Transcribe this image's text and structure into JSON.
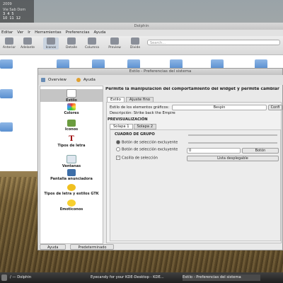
{
  "clock": {
    "year": "2009",
    "date": "Vie Sab Dom",
    "days": [
      "3",
      "4",
      "5"
    ],
    "days2": [
      "10",
      "11",
      "12"
    ]
  },
  "dolphin": {
    "title": "Dolphin",
    "menu": [
      "Editar",
      "Ver",
      "Ir",
      "Herramientas",
      "Preferencias",
      "Ayuda"
    ],
    "toolbar": [
      "Anterior",
      "Adelante",
      "Iconos",
      "Detalle",
      "Columna",
      "Preview",
      "Divide"
    ],
    "search_placeholder": "Search..."
  },
  "estilo": {
    "title": "Estilo - Preferencias del sistema",
    "top_links": [
      "Overview",
      "Ayuda"
    ],
    "sidebar": [
      "Estilo",
      "Colores",
      "Iconos",
      "Tipos de letra",
      "Ventanas",
      "Pantalla anunciadora",
      "Tipos de letra y estilos GTK",
      "Emoticonos"
    ],
    "header": "Permite la manipulación del comportamiento del widget y permite cambiar el estilo pa",
    "tabs": [
      "Estilo",
      "Ajuste fino"
    ],
    "widget_style_label": "Estilo de los elementos gráficos:",
    "widget_style_value": "Bespin",
    "configure_label": "Confi",
    "description": "Descripción: Strike back the Empire",
    "preview_label": "PREVISUALIZACIÓN",
    "subtabs": [
      "Solapa 1",
      "Solapa 2"
    ],
    "group_label": "CUADRO DE GRUPO",
    "radio1": "Botón de selección excluyente",
    "radio2": "Botón de selección excluyente",
    "checkbox": "Casilla de selección",
    "spin_value": "0",
    "button_label": "Botón",
    "list_label": "Lista desplegable",
    "bottom_buttons": [
      "Ayuda",
      "Predeterminado"
    ]
  },
  "taskbar": {
    "items": [
      "/ — Dolphin",
      "Eyecandy for your KDE-Desktop - KDE...",
      "Estilo - Preferencias del sistema"
    ]
  }
}
